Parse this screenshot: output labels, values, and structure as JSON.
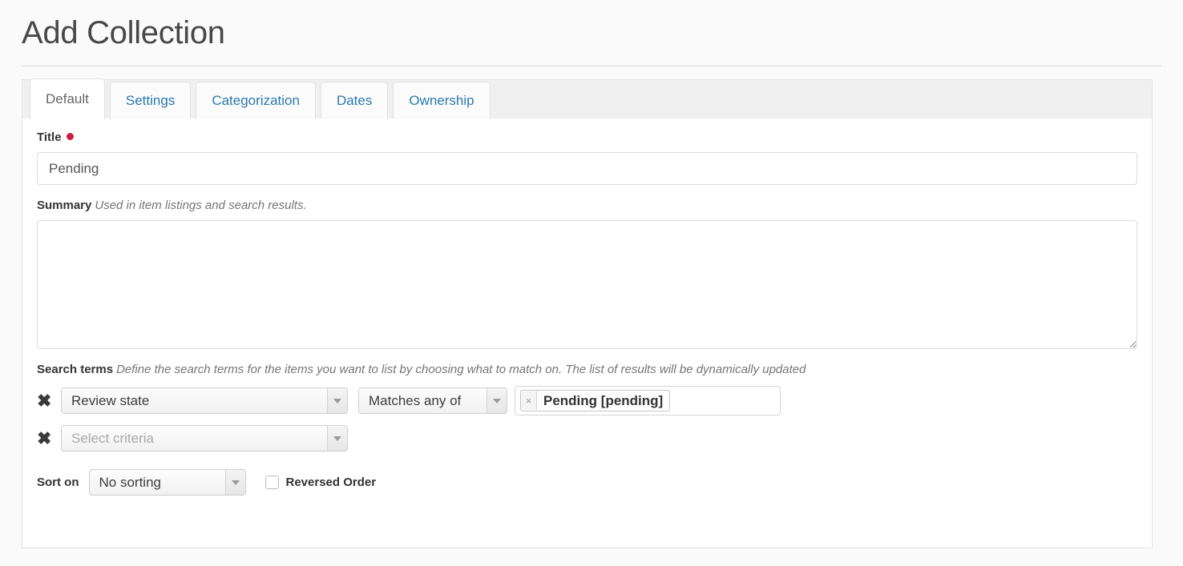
{
  "header": {
    "title": "Add Collection"
  },
  "tabs": [
    {
      "label": "Default",
      "active": true
    },
    {
      "label": "Settings",
      "active": false
    },
    {
      "label": "Categorization",
      "active": false
    },
    {
      "label": "Dates",
      "active": false
    },
    {
      "label": "Ownership",
      "active": false
    }
  ],
  "form": {
    "title_field": {
      "label": "Title",
      "required": true,
      "value": "Pending",
      "placeholder": ""
    },
    "summary_field": {
      "label": "Summary",
      "hint": "Used in item listings and search results.",
      "value": "",
      "placeholder": ""
    },
    "search_terms": {
      "label": "Search terms",
      "hint": "Define the search terms for the items you want to list by choosing what to match on. The list of results will be dynamically updated",
      "rows": [
        {
          "remove_icon": "close-x-icon",
          "criteria": "Review state",
          "criteria_is_placeholder": false,
          "operator": "Matches any of",
          "has_operator": true,
          "has_tokens": true,
          "tokens": [
            {
              "label": "Pending [pending]",
              "remove_icon": "token-remove-icon"
            }
          ]
        },
        {
          "remove_icon": "close-x-icon",
          "criteria": "Select criteria",
          "criteria_is_placeholder": true,
          "operator": "",
          "has_operator": false,
          "has_tokens": false,
          "tokens": []
        }
      ]
    },
    "sort": {
      "label": "Sort on",
      "value": "No sorting",
      "reversed_label": "Reversed Order",
      "reversed_checked": false
    }
  },
  "colors": {
    "page_background": "#fafafa",
    "panel_background": "#ffffff",
    "tabstrip_background": "#f0f0f0",
    "link_blue": "#2a7ab0",
    "heading_gray": "#484848",
    "required_red": "#cc1e44",
    "border_gray": "#dcdcdc"
  }
}
